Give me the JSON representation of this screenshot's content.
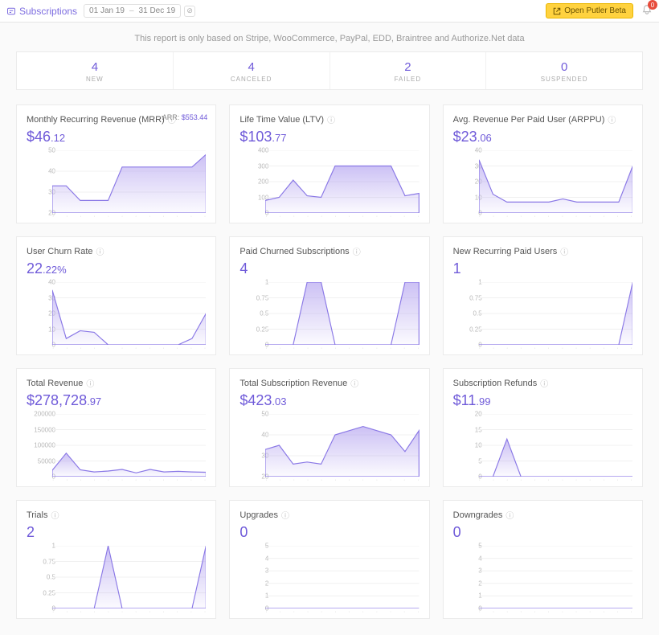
{
  "topbar": {
    "section_label": "Subscriptions",
    "date_from": "01 Jan 19",
    "date_to": "31 Dec 19",
    "open_beta_label": "Open Putler Beta",
    "notification_count": "0"
  },
  "disclaimer": "This report is only based on Stripe, WooCommerce, PayPal, EDD, Braintree and Authorize.Net data",
  "summary": [
    {
      "value": "4",
      "label": "NEW"
    },
    {
      "value": "4",
      "label": "CANCELED"
    },
    {
      "value": "2",
      "label": "FAILED"
    },
    {
      "value": "0",
      "label": "SUSPENDED"
    }
  ],
  "cards": [
    {
      "title": "Monthly Recurring Revenue (MRR)",
      "prefix": "$",
      "int": "46",
      "dec": ".12",
      "arr_label": "ARR:",
      "arr_value": "$553.44"
    },
    {
      "title": "Life Time Value (LTV)",
      "prefix": "$",
      "int": "103",
      "dec": ".77"
    },
    {
      "title": "Avg. Revenue Per Paid User (ARPPU)",
      "prefix": "$",
      "int": "23",
      "dec": ".06"
    },
    {
      "title": "User Churn Rate",
      "prefix": "",
      "int": "22",
      "dec": ".22%"
    },
    {
      "title": "Paid Churned Subscriptions",
      "prefix": "",
      "int": "4",
      "dec": ""
    },
    {
      "title": "New Recurring Paid Users",
      "prefix": "",
      "int": "1",
      "dec": ""
    },
    {
      "title": "Total Revenue",
      "prefix": "$",
      "int": "278,728",
      "dec": ".97"
    },
    {
      "title": "Total Subscription Revenue",
      "prefix": "$",
      "int": "423",
      "dec": ".03"
    },
    {
      "title": "Subscription Refunds",
      "prefix": "$",
      "int": "11",
      "dec": ".99"
    },
    {
      "title": "Trials",
      "prefix": "",
      "int": "2",
      "dec": ""
    },
    {
      "title": "Upgrades",
      "prefix": "",
      "int": "0",
      "dec": ""
    },
    {
      "title": "Downgrades",
      "prefix": "",
      "int": "0",
      "dec": ""
    }
  ],
  "chart_data": [
    {
      "type": "area",
      "title": "Monthly Recurring Revenue (MRR)",
      "ylim": [
        20,
        50
      ],
      "yticks": [
        20,
        30,
        40,
        50
      ],
      "x": [
        1,
        2,
        3,
        4,
        5,
        6,
        7,
        8,
        9,
        10,
        11,
        12
      ],
      "values": [
        33,
        33,
        26,
        26,
        26,
        42,
        42,
        42,
        42,
        42,
        42,
        48
      ]
    },
    {
      "type": "area",
      "title": "Life Time Value (LTV)",
      "ylim": [
        0,
        400
      ],
      "yticks": [
        0,
        100,
        200,
        300,
        400
      ],
      "x": [
        1,
        2,
        3,
        4,
        5,
        6,
        7,
        8,
        9,
        10,
        11,
        12
      ],
      "values": [
        80,
        100,
        210,
        110,
        100,
        300,
        300,
        300,
        300,
        300,
        110,
        125
      ]
    },
    {
      "type": "area",
      "title": "Avg. Revenue Per Paid User (ARPPU)",
      "ylim": [
        0,
        40
      ],
      "yticks": [
        0,
        10,
        20,
        30,
        40
      ],
      "x": [
        1,
        2,
        3,
        4,
        5,
        6,
        7,
        8,
        9,
        10,
        11,
        12
      ],
      "values": [
        34,
        12,
        7,
        7,
        7,
        7,
        9,
        7,
        7,
        7,
        7,
        30
      ]
    },
    {
      "type": "area",
      "title": "User Churn Rate",
      "ylim": [
        0,
        40
      ],
      "yticks": [
        0,
        10,
        20,
        30,
        40
      ],
      "x": [
        1,
        2,
        3,
        4,
        5,
        6,
        7,
        8,
        9,
        10,
        11,
        12
      ],
      "values": [
        35,
        4,
        9,
        8,
        0,
        0,
        0,
        0,
        0,
        0,
        4,
        20
      ]
    },
    {
      "type": "area",
      "title": "Paid Churned Subscriptions",
      "ylim": [
        0,
        1
      ],
      "yticks": [
        0,
        0.25,
        0.5,
        0.75,
        1
      ],
      "x": [
        1,
        2,
        3,
        4,
        5,
        6,
        7,
        8,
        9,
        10,
        11,
        12
      ],
      "values": [
        0,
        0,
        0,
        1,
        1,
        0,
        0,
        0,
        0,
        0,
        1,
        1
      ]
    },
    {
      "type": "area",
      "title": "New Recurring Paid Users",
      "ylim": [
        0,
        1
      ],
      "yticks": [
        0,
        0.25,
        0.5,
        0.75,
        1
      ],
      "x": [
        1,
        2,
        3,
        4,
        5,
        6,
        7,
        8,
        9,
        10,
        11,
        12
      ],
      "values": [
        0,
        0,
        0,
        0,
        0,
        0,
        0,
        0,
        0,
        0,
        0,
        1
      ]
    },
    {
      "type": "area",
      "title": "Total Revenue",
      "ylim": [
        0,
        200000
      ],
      "yticks": [
        0,
        50000,
        100000,
        150000,
        200000
      ],
      "x": [
        1,
        2,
        3,
        4,
        5,
        6,
        7,
        8,
        9,
        10,
        11,
        12
      ],
      "values": [
        20000,
        75000,
        22000,
        15000,
        18000,
        23000,
        12000,
        23000,
        15000,
        17000,
        15000,
        14000
      ]
    },
    {
      "type": "area",
      "title": "Total Subscription Revenue",
      "ylim": [
        20,
        50
      ],
      "yticks": [
        20,
        30,
        40,
        50
      ],
      "x": [
        1,
        2,
        3,
        4,
        5,
        6,
        7,
        8,
        9,
        10,
        11,
        12
      ],
      "values": [
        33,
        35,
        26,
        27,
        26,
        40,
        42,
        44,
        42,
        40,
        32,
        42
      ]
    },
    {
      "type": "area",
      "title": "Subscription Refunds",
      "ylim": [
        0,
        20
      ],
      "yticks": [
        0,
        5,
        10,
        15,
        20
      ],
      "x": [
        1,
        2,
        3,
        4,
        5,
        6,
        7,
        8,
        9,
        10,
        11,
        12
      ],
      "values": [
        0,
        0,
        12,
        0,
        0,
        0,
        0,
        0,
        0,
        0,
        0,
        0
      ]
    },
    {
      "type": "area",
      "title": "Trials",
      "ylim": [
        0,
        1
      ],
      "yticks": [
        0,
        0.25,
        0.5,
        0.75,
        1
      ],
      "x": [
        1,
        2,
        3,
        4,
        5,
        6,
        7,
        8,
        9,
        10,
        11,
        12
      ],
      "values": [
        0,
        0,
        0,
        0,
        1,
        0,
        0,
        0,
        0,
        0,
        0,
        1
      ]
    },
    {
      "type": "area",
      "title": "Upgrades",
      "ylim": [
        0,
        5
      ],
      "yticks": [
        0,
        1,
        2,
        3,
        4,
        5
      ],
      "x": [
        1,
        2,
        3,
        4,
        5,
        6,
        7,
        8,
        9,
        10,
        11,
        12
      ],
      "values": [
        0,
        0,
        0,
        0,
        0,
        0,
        0,
        0,
        0,
        0,
        0,
        0
      ]
    },
    {
      "type": "area",
      "title": "Downgrades",
      "ylim": [
        0,
        5
      ],
      "yticks": [
        0,
        1,
        2,
        3,
        4,
        5
      ],
      "x": [
        1,
        2,
        3,
        4,
        5,
        6,
        7,
        8,
        9,
        10,
        11,
        12
      ],
      "values": [
        0,
        0,
        0,
        0,
        0,
        0,
        0,
        0,
        0,
        0,
        0,
        0
      ]
    }
  ]
}
